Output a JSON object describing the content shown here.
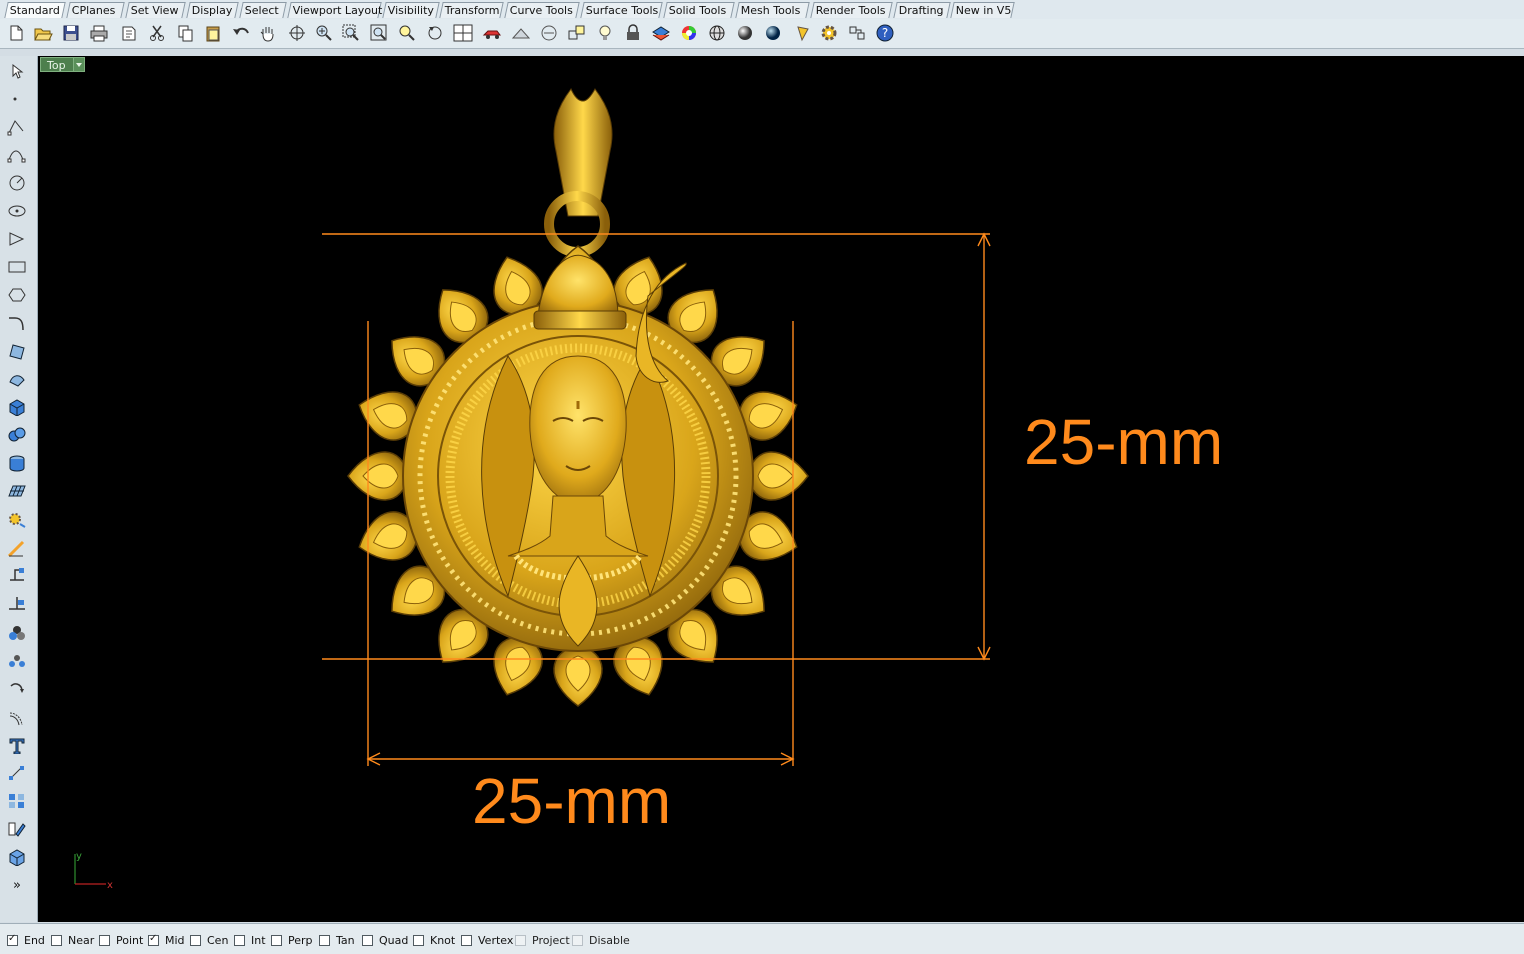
{
  "tabs": [
    "Standard",
    "CPlanes",
    "Set View",
    "Display",
    "Select",
    "Viewport Layout",
    "Visibility",
    "Transform",
    "Curve Tools",
    "Surface Tools",
    "Solid Tools",
    "Mesh Tools",
    "Render Tools",
    "Drafting",
    "New in V5"
  ],
  "active_tab": "Standard",
  "viewport": {
    "name": "Top"
  },
  "dimensions": {
    "width_label": "25-mm",
    "height_label": "25-mm"
  },
  "axis": {
    "x": "x",
    "y": "y"
  },
  "left_tools_more": "»",
  "colors": {
    "dimension": "#ff8a1c",
    "viewport_bg": "#000000",
    "gold": "#d9a51a"
  },
  "osnaps": [
    {
      "label": "End",
      "checked": true
    },
    {
      "label": "Near",
      "checked": false
    },
    {
      "label": "Point",
      "checked": false
    },
    {
      "label": "Mid",
      "checked": true
    },
    {
      "label": "Cen",
      "checked": false
    },
    {
      "label": "Int",
      "checked": false
    },
    {
      "label": "Perp",
      "checked": false
    },
    {
      "label": "Tan",
      "checked": false
    },
    {
      "label": "Quad",
      "checked": false
    },
    {
      "label": "Knot",
      "checked": false
    },
    {
      "label": "Vertex",
      "checked": false
    },
    {
      "label": "Project",
      "checked": false,
      "disabled": true
    },
    {
      "label": "Disable",
      "checked": false,
      "disabled": true
    }
  ]
}
